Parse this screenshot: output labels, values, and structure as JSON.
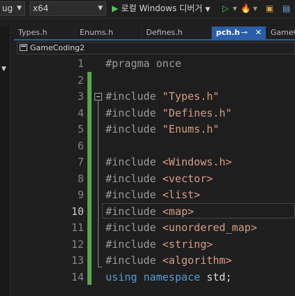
{
  "toolbar": {
    "config_dropdown": "ug",
    "platform_dropdown": "x64",
    "run_label": "로컬 Windows 디버거"
  },
  "tabs": [
    {
      "label": "Types.h"
    },
    {
      "label": "Enums.h"
    },
    {
      "label": "Defines.h"
    },
    {
      "label": "pch.h",
      "pin": "⊸",
      "close": "✕"
    },
    {
      "label": "GameCo"
    }
  ],
  "navbar": {
    "project": "GameCoding2"
  },
  "editor": {
    "current_line": 10,
    "lines": [
      {
        "n": "1",
        "pp": "#pragma once",
        "arg": ""
      },
      {
        "n": "2",
        "pp": "",
        "arg": ""
      },
      {
        "n": "3",
        "pp": "#include ",
        "arg": "\"Types.h\""
      },
      {
        "n": "4",
        "pp": "#include ",
        "arg": "\"Defines.h\""
      },
      {
        "n": "5",
        "pp": "#include ",
        "arg": "\"Enums.h\""
      },
      {
        "n": "6",
        "pp": "",
        "arg": ""
      },
      {
        "n": "7",
        "pp": "#include ",
        "arg": "<Windows.h>"
      },
      {
        "n": "8",
        "pp": "#include ",
        "arg": "<vector>"
      },
      {
        "n": "9",
        "pp": "#include ",
        "arg": "<list>"
      },
      {
        "n": "10",
        "pp": "#include ",
        "arg": "<map>"
      },
      {
        "n": "11",
        "pp": "#include ",
        "arg": "<unordered_map>"
      },
      {
        "n": "12",
        "pp": "#include ",
        "arg": "<string>"
      },
      {
        "n": "13",
        "pp": "#include ",
        "arg": "<algorithm>"
      }
    ],
    "last_line": {
      "n": "14",
      "kw1": "using",
      "kw2": "namespace",
      "rest": "std;"
    }
  }
}
